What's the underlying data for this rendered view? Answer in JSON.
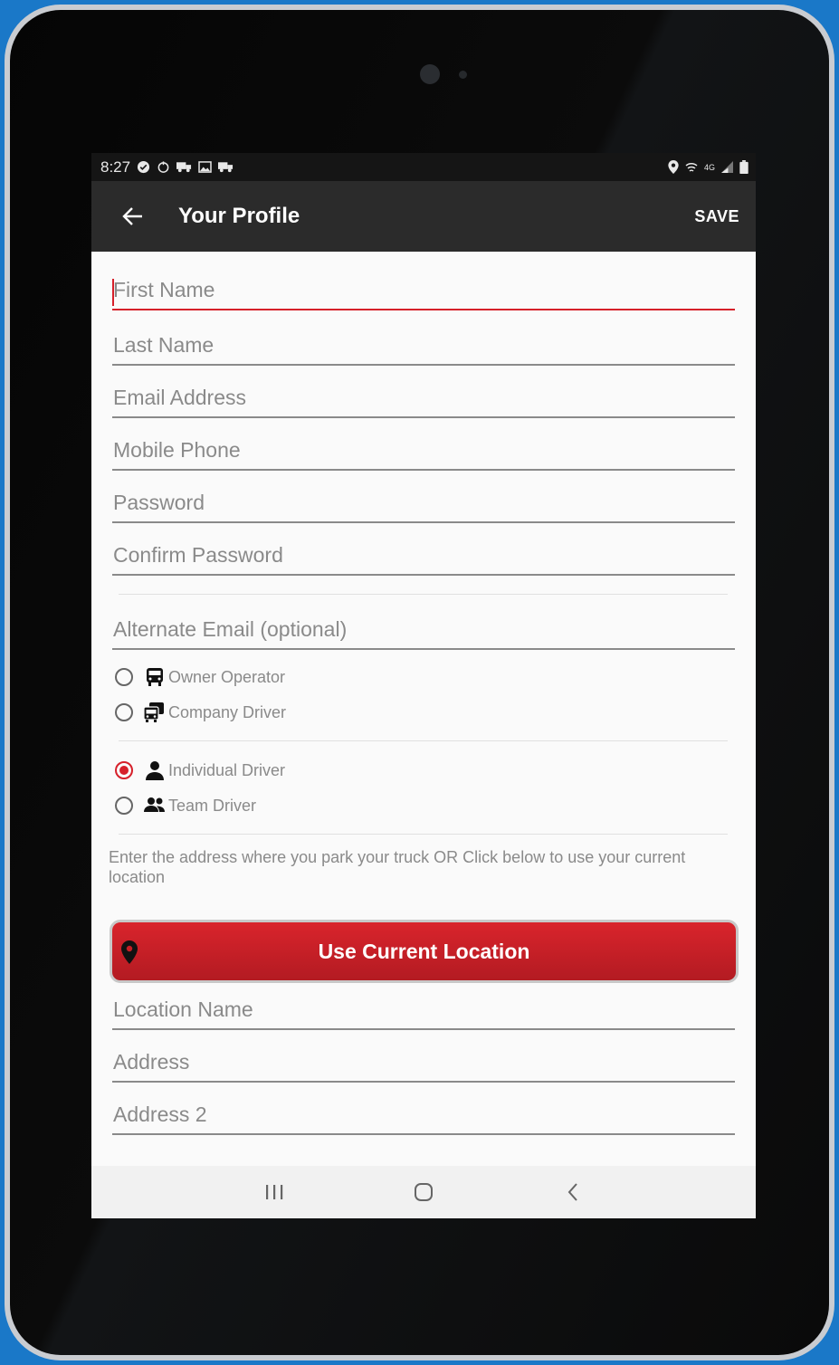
{
  "status_bar": {
    "time": "8:27",
    "left_icons": [
      "check-circle-icon",
      "sync-icon",
      "truck-icon",
      "image-icon",
      "truck-icon"
    ],
    "right_icons": [
      "location-icon",
      "wifi-icon",
      "signal-icon",
      "battery-icon"
    ],
    "network_label": "4G"
  },
  "app_bar": {
    "title": "Your Profile",
    "save_label": "SAVE"
  },
  "form": {
    "first_name": {
      "placeholder": "First Name",
      "value": ""
    },
    "last_name": {
      "placeholder": "Last Name",
      "value": ""
    },
    "email": {
      "placeholder": "Email Address",
      "value": ""
    },
    "mobile": {
      "placeholder": "Mobile Phone",
      "value": ""
    },
    "password": {
      "placeholder": "Password",
      "value": ""
    },
    "confirm_password": {
      "placeholder": "Confirm Password",
      "value": ""
    },
    "alt_email": {
      "placeholder": "Alternate Email (optional)",
      "value": ""
    },
    "driver_type": {
      "options": [
        {
          "label": "Owner Operator",
          "icon": "bus-icon",
          "checked": false
        },
        {
          "label": "Company Driver",
          "icon": "truck-fleet-icon",
          "checked": false
        }
      ]
    },
    "driver_mode": {
      "options": [
        {
          "label": "Individual Driver",
          "icon": "person-icon",
          "checked": true
        },
        {
          "label": "Team Driver",
          "icon": "people-icon",
          "checked": false
        }
      ]
    },
    "location_hint": "Enter the address where you park your truck OR Click below to use your current location",
    "use_location_label": "Use Current Location",
    "location_name": {
      "placeholder": "Location Name",
      "value": ""
    },
    "address": {
      "placeholder": "Address",
      "value": ""
    },
    "address2": {
      "placeholder": "Address 2",
      "value": ""
    }
  },
  "colors": {
    "accent": "#d6202a",
    "app_bar": "#2b2b2b",
    "status_bar": "#151515",
    "background": "#1a78c8"
  }
}
